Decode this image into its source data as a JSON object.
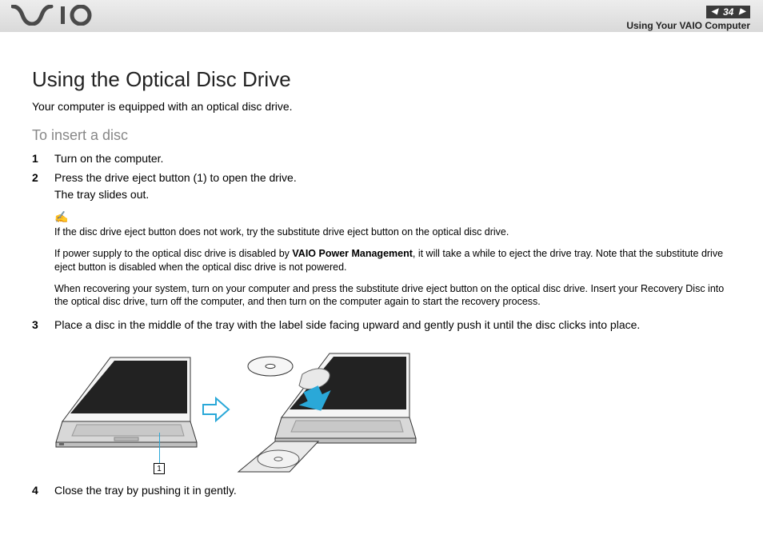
{
  "header": {
    "logo_text": "VAIO",
    "page_number": "34",
    "breadcrumb": "Using Your VAIO Computer"
  },
  "title": "Using the Optical Disc Drive",
  "intro": "Your computer is equipped with an optical disc drive.",
  "subhead": "To insert a disc",
  "steps": {
    "s1": {
      "n": "1",
      "t": "Turn on the computer."
    },
    "s2": {
      "n": "2",
      "t1": "Press the drive eject button (1) to open the drive.",
      "t2": "The tray slides out."
    },
    "s3": {
      "n": "3",
      "t": "Place a disc in the middle of the tray with the label side facing upward and gently push it until the disc clicks into place."
    },
    "s4": {
      "n": "4",
      "t": "Close the tray by pushing it in gently."
    }
  },
  "notes": {
    "n1": "If the disc drive eject button does not work, try the substitute drive eject button on the optical disc drive.",
    "n2a": "If power supply to the optical disc drive is disabled by ",
    "n2b": "VAIO Power Management",
    "n2c": ", it will take a while to eject the drive tray. Note that the substitute drive eject button is disabled when the optical disc drive is not powered.",
    "n3": "When recovering your system, turn on your computer and press the substitute drive eject button on the optical disc drive. Insert your Recovery Disc into the optical disc drive, turn off the computer, and then turn on the computer again to start the recovery process."
  },
  "callout": "1"
}
